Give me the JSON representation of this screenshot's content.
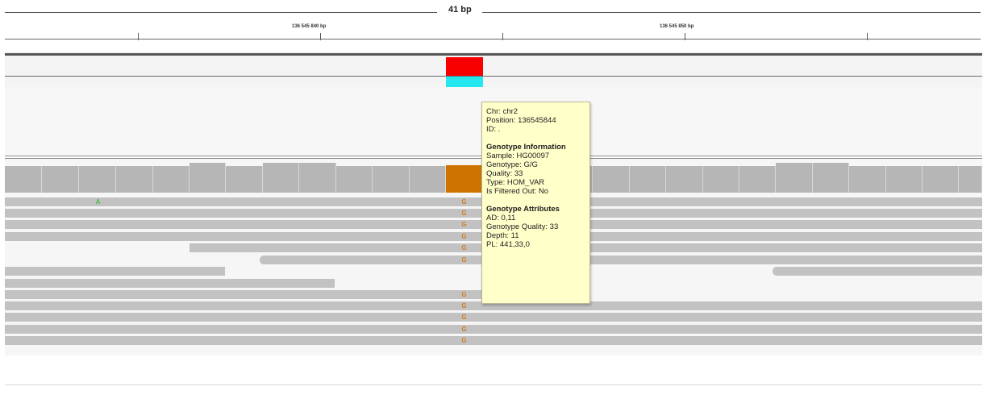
{
  "ruler": {
    "span_label": "41 bp",
    "positions": [
      "136 545 840 bp",
      "136 545 850 bp"
    ]
  },
  "reads": {
    "mismatch_a": "A",
    "mismatch_g": "G"
  },
  "tooltip": {
    "chr": "Chr: chr2",
    "position": "Position: 136545844",
    "id": "ID: .",
    "genotype_heading": "Genotype Information",
    "sample": "Sample: HG00097",
    "genotype": "Genotype: G/G",
    "quality": "Quality: 33",
    "type": "Type: HOM_VAR",
    "filtered": "Is Filtered Out: No",
    "attributes_heading": "Genotype Attributes",
    "ad": "AD: 0,11",
    "genotype_quality": "Genotype Quality: 33",
    "depth": "Depth: 11",
    "pl": "PL: 441,33,0"
  },
  "colors": {
    "variant_hom": "#f80000",
    "genotype_hom_var": "#25e7f0",
    "coverage_variant": "#cf7300",
    "coverage_bar": "#b6b6b6",
    "read": "#c2c2c2",
    "mismatch_g": "#d07a1e",
    "mismatch_a": "#4cbb45",
    "tooltip_bg": "#ffffca"
  }
}
